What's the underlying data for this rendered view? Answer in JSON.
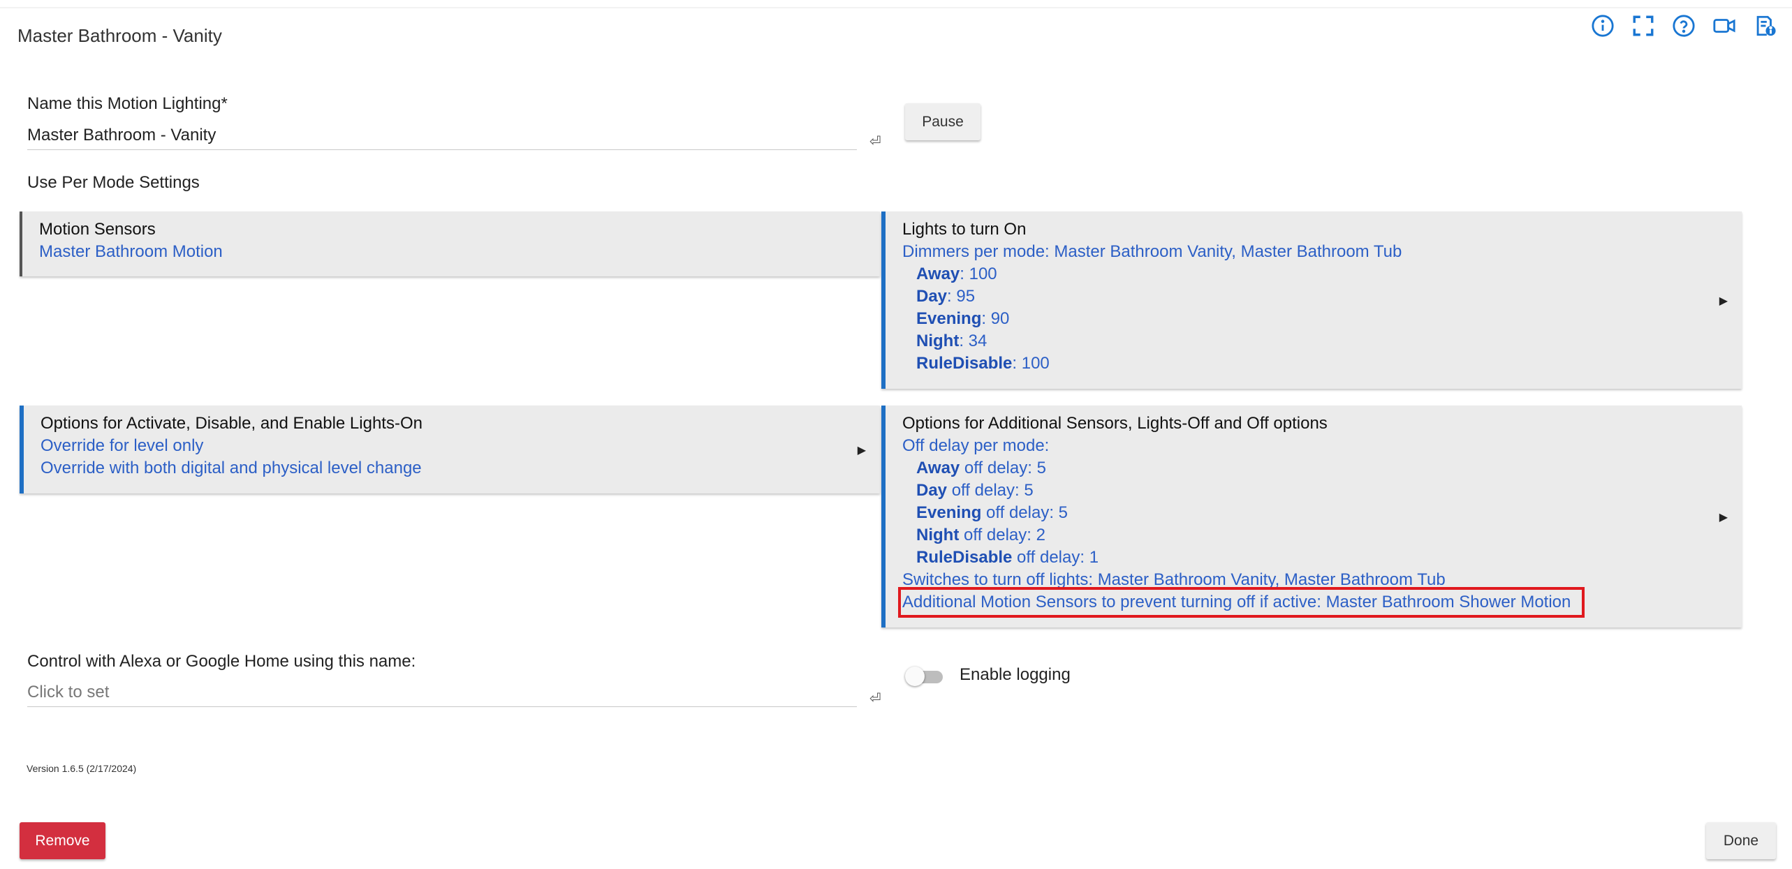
{
  "header": {
    "title": "Master Bathroom - Vanity",
    "icons": [
      "info-icon",
      "fullscreen-icon",
      "help-icon",
      "video-icon",
      "log-icon"
    ]
  },
  "name_field": {
    "label": "Name this Motion Lighting*",
    "value": "Master Bathroom - Vanity"
  },
  "pause_button": "Pause",
  "per_mode_label": "Use Per Mode Settings",
  "motion_sensors": {
    "title": "Motion Sensors",
    "value": "Master Bathroom Motion"
  },
  "lights_on": {
    "title": "Lights to turn On",
    "summary": "Dimmers per mode: Master Bathroom Vanity, Master Bathroom Tub",
    "modes": [
      {
        "mode": "Away",
        "value": ": 100"
      },
      {
        "mode": "Day",
        "value": ": 95"
      },
      {
        "mode": "Evening",
        "value": ": 90"
      },
      {
        "mode": "Night",
        "value": ": 34"
      },
      {
        "mode": "RuleDisable",
        "value": ": 100"
      }
    ]
  },
  "options_activate": {
    "title": "Options for Activate, Disable, and Enable Lights-On",
    "lines": [
      "Override for level only",
      "Override with both digital and physical level change"
    ]
  },
  "options_additional": {
    "title": "Options for Additional Sensors, Lights-Off and Off options",
    "summary": "Off delay per mode:",
    "modes": [
      {
        "mode": "Away",
        "value": " off delay: 5"
      },
      {
        "mode": "Day",
        "value": " off delay: 5"
      },
      {
        "mode": "Evening",
        "value": " off delay: 5"
      },
      {
        "mode": "Night",
        "value": " off delay: 2"
      },
      {
        "mode": "RuleDisable",
        "value": " off delay: 1"
      }
    ],
    "switches": "Switches to turn off lights: Master Bathroom Vanity, Master Bathroom Tub",
    "additional_sensors": "Additional Motion Sensors to prevent turning off if active: Master Bathroom Shower Motion"
  },
  "alexa_field": {
    "label": "Control with Alexa or Google Home using this name:",
    "placeholder": "Click to set"
  },
  "logging": {
    "label": "Enable logging",
    "enabled": false
  },
  "version": "Version 1.6.5 (2/17/2024)",
  "remove_button": "Remove",
  "done_button": "Done",
  "colors": {
    "accent": "#1e6fc4",
    "link": "#2c5fc6",
    "danger": "#d32f3f",
    "highlight_box": "#e0191e"
  }
}
